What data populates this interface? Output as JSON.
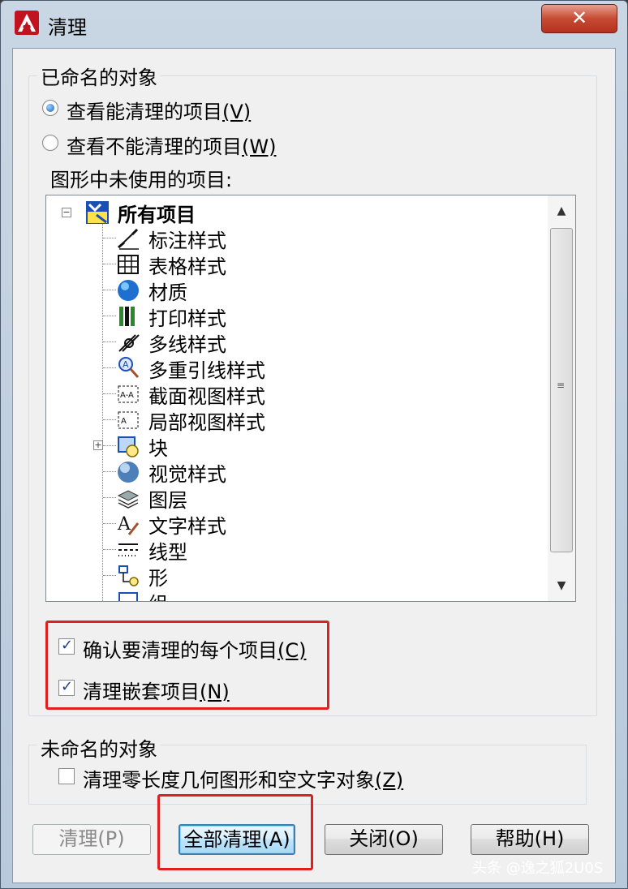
{
  "window": {
    "title": "清理",
    "close_label": "✕"
  },
  "named_objects": {
    "group_label": "已命名的对象",
    "radio_purgeable": {
      "text": "查看能清理的项目",
      "hotkey": "(V)",
      "checked": true
    },
    "radio_nonpurgeable": {
      "text": "查看不能清理的项目",
      "hotkey": "(W)",
      "checked": false
    },
    "tree_caption": "图形中未使用的项目:",
    "tree": {
      "root": "所有项目",
      "items": [
        {
          "label": "标注样式",
          "icon": "dimension-style-icon"
        },
        {
          "label": "表格样式",
          "icon": "table-style-icon"
        },
        {
          "label": "材质",
          "icon": "material-icon"
        },
        {
          "label": "打印样式",
          "icon": "plot-style-icon"
        },
        {
          "label": "多线样式",
          "icon": "multiline-style-icon"
        },
        {
          "label": "多重引线样式",
          "icon": "multileader-style-icon"
        },
        {
          "label": "截面视图样式",
          "icon": "section-view-style-icon"
        },
        {
          "label": "局部视图样式",
          "icon": "detail-view-style-icon"
        },
        {
          "label": "块",
          "icon": "block-icon"
        },
        {
          "label": "视觉样式",
          "icon": "visual-style-icon"
        },
        {
          "label": "图层",
          "icon": "layer-icon"
        },
        {
          "label": "文字样式",
          "icon": "text-style-icon"
        },
        {
          "label": "线型",
          "icon": "linetype-icon"
        },
        {
          "label": "形",
          "icon": "shape-icon"
        },
        {
          "label": "组",
          "icon": "group-icon"
        }
      ]
    },
    "check_confirm": {
      "text": "确认要清理的每个项目",
      "hotkey": "(C)",
      "checked": true
    },
    "check_nested": {
      "text": "清理嵌套项目",
      "hotkey": "(N)",
      "checked": true
    }
  },
  "unnamed_objects": {
    "group_label": "未命名的对象",
    "check_zero_length": {
      "text": "清理零长度几何图形和空文字对象",
      "hotkey": "(Z)",
      "checked": false
    }
  },
  "buttons": {
    "purge": "清理(P)",
    "purge_all": "全部清理(A)",
    "close": "关闭(O)",
    "help": "帮助(H)"
  },
  "watermark": "头条 @逸之狐2U0S",
  "colors": {
    "highlight_box": "#e02020",
    "accent": "#3c7fb1"
  }
}
